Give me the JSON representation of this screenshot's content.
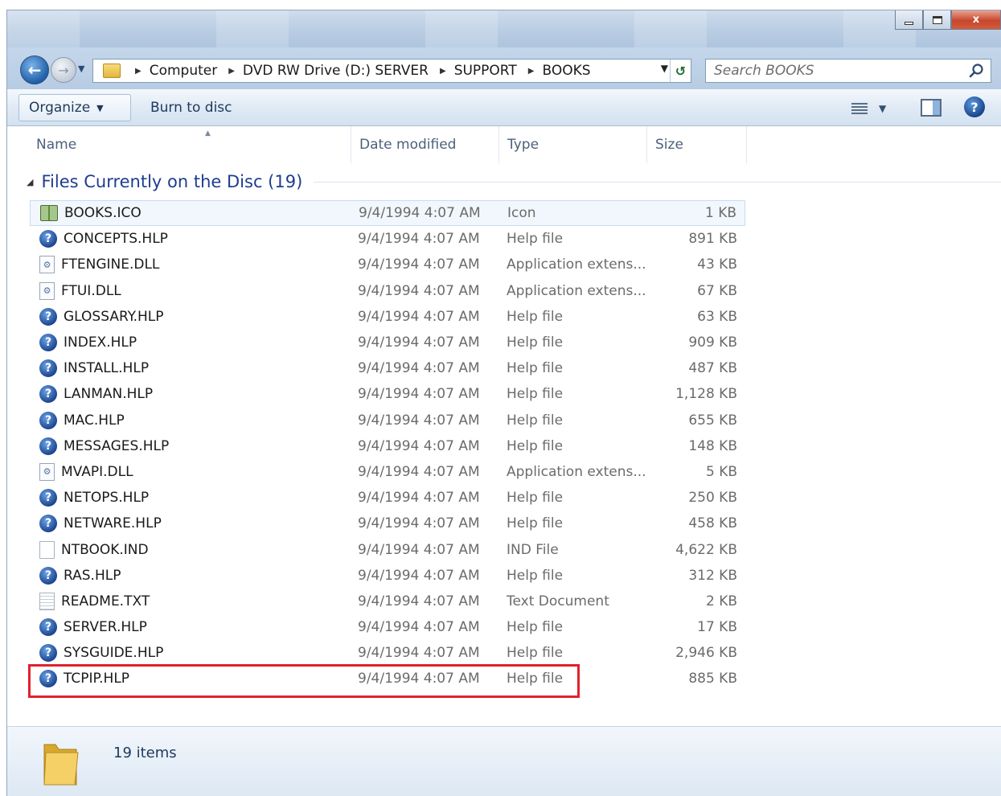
{
  "window": {
    "caption_buttons": {
      "minimize": "minimize",
      "maximize": "maximize",
      "close": "x"
    }
  },
  "address": {
    "breadcrumbs": [
      "Computer",
      "DVD RW Drive (D:) SERVER",
      "SUPPORT",
      "BOOKS"
    ],
    "search_placeholder": "Search BOOKS"
  },
  "commandbar": {
    "organize_label": "Organize",
    "burn_label": "Burn to disc"
  },
  "columns": {
    "name": "Name",
    "date": "Date modified",
    "type": "Type",
    "size": "Size"
  },
  "group": {
    "title": "Files Currently on the Disc (19)"
  },
  "files": [
    {
      "name": "BOOKS.ICO",
      "date": "9/4/1994 4:07 AM",
      "type": "Icon",
      "size": "1 KB",
      "icon": "icon-file-icon"
    },
    {
      "name": "CONCEPTS.HLP",
      "date": "9/4/1994 4:07 AM",
      "type": "Help file",
      "size": "891 KB",
      "icon": "help-file-icon"
    },
    {
      "name": "FTENGINE.DLL",
      "date": "9/4/1994 4:07 AM",
      "type": "Application extens...",
      "size": "43 KB",
      "icon": "dll-file-icon"
    },
    {
      "name": "FTUI.DLL",
      "date": "9/4/1994 4:07 AM",
      "type": "Application extens...",
      "size": "67 KB",
      "icon": "dll-file-icon"
    },
    {
      "name": "GLOSSARY.HLP",
      "date": "9/4/1994 4:07 AM",
      "type": "Help file",
      "size": "63 KB",
      "icon": "help-file-icon"
    },
    {
      "name": "INDEX.HLP",
      "date": "9/4/1994 4:07 AM",
      "type": "Help file",
      "size": "909 KB",
      "icon": "help-file-icon"
    },
    {
      "name": "INSTALL.HLP",
      "date": "9/4/1994 4:07 AM",
      "type": "Help file",
      "size": "487 KB",
      "icon": "help-file-icon"
    },
    {
      "name": "LANMAN.HLP",
      "date": "9/4/1994 4:07 AM",
      "type": "Help file",
      "size": "1,128 KB",
      "icon": "help-file-icon"
    },
    {
      "name": "MAC.HLP",
      "date": "9/4/1994 4:07 AM",
      "type": "Help file",
      "size": "655 KB",
      "icon": "help-file-icon"
    },
    {
      "name": "MESSAGES.HLP",
      "date": "9/4/1994 4:07 AM",
      "type": "Help file",
      "size": "148 KB",
      "icon": "help-file-icon"
    },
    {
      "name": "MVAPI.DLL",
      "date": "9/4/1994 4:07 AM",
      "type": "Application extens...",
      "size": "5 KB",
      "icon": "dll-file-icon"
    },
    {
      "name": "NETOPS.HLP",
      "date": "9/4/1994 4:07 AM",
      "type": "Help file",
      "size": "250 KB",
      "icon": "help-file-icon"
    },
    {
      "name": "NETWARE.HLP",
      "date": "9/4/1994 4:07 AM",
      "type": "Help file",
      "size": "458 KB",
      "icon": "help-file-icon"
    },
    {
      "name": "NTBOOK.IND",
      "date": "9/4/1994 4:07 AM",
      "type": "IND File",
      "size": "4,622 KB",
      "icon": "blank-file-icon"
    },
    {
      "name": "RAS.HLP",
      "date": "9/4/1994 4:07 AM",
      "type": "Help file",
      "size": "312 KB",
      "icon": "help-file-icon"
    },
    {
      "name": "README.TXT",
      "date": "9/4/1994 4:07 AM",
      "type": "Text Document",
      "size": "2 KB",
      "icon": "text-file-icon"
    },
    {
      "name": "SERVER.HLP",
      "date": "9/4/1994 4:07 AM",
      "type": "Help file",
      "size": "17 KB",
      "icon": "help-file-icon"
    },
    {
      "name": "SYSGUIDE.HLP",
      "date": "9/4/1994 4:07 AM",
      "type": "Help file",
      "size": "2,946 KB",
      "icon": "help-file-icon"
    },
    {
      "name": "TCPIP.HLP",
      "date": "9/4/1994 4:07 AM",
      "type": "Help file",
      "size": "885 KB",
      "icon": "help-file-icon"
    }
  ],
  "status": {
    "items_text": "19 items"
  },
  "colors": {
    "highlight": "#e0222e",
    "group_title": "#1e3d8f",
    "titlebar": "#b9cde3"
  }
}
